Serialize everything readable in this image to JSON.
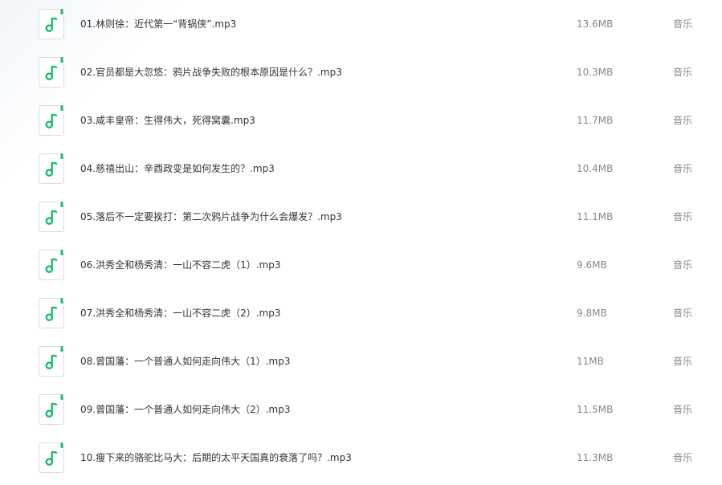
{
  "files": [
    {
      "name": "01.林则徐：近代第一“背锅侠”.mp3",
      "size": "13.6MB",
      "type": "音乐",
      "icon": "music-note-icon"
    },
    {
      "name": "02.官员都是大忽悠：鸦片战争失败的根本原因是什么？.mp3",
      "size": "10.3MB",
      "type": "音乐",
      "icon": "music-note-icon"
    },
    {
      "name": "03.咸丰皇帝：生得伟大，死得窝囊.mp3",
      "size": "11.7MB",
      "type": "音乐",
      "icon": "music-note-icon"
    },
    {
      "name": "04.慈禧出山：辛酉政变是如何发生的？.mp3",
      "size": "10.4MB",
      "type": "音乐",
      "icon": "music-note-icon"
    },
    {
      "name": "05.落后不一定要挨打：第二次鸦片战争为什么会爆发？.mp3",
      "size": "11.1MB",
      "type": "音乐",
      "icon": "music-note-icon"
    },
    {
      "name": "06.洪秀全和杨秀清：一山不容二虎（1）.mp3",
      "size": "9.6MB",
      "type": "音乐",
      "icon": "music-note-icon"
    },
    {
      "name": "07.洪秀全和杨秀清：一山不容二虎（2）.mp3",
      "size": "9.8MB",
      "type": "音乐",
      "icon": "music-note-icon"
    },
    {
      "name": "08.曾国藩：一个普通人如何走向伟大（1）.mp3",
      "size": "11MB",
      "type": "音乐",
      "icon": "music-note-icon"
    },
    {
      "name": "09.曾国藩：一个普通人如何走向伟大（2）.mp3",
      "size": "11.5MB",
      "type": "音乐",
      "icon": "music-note-icon"
    },
    {
      "name": "10.瘦下来的骆驼比马大：后期的太平天国真的衰落了吗？.mp3",
      "size": "11.3MB",
      "type": "音乐",
      "icon": "music-note-icon"
    }
  ],
  "colors": {
    "icon_accent": "#23b86e",
    "icon_border": "#dcdcdc",
    "name_text": "#333333",
    "meta_text": "#888888"
  }
}
